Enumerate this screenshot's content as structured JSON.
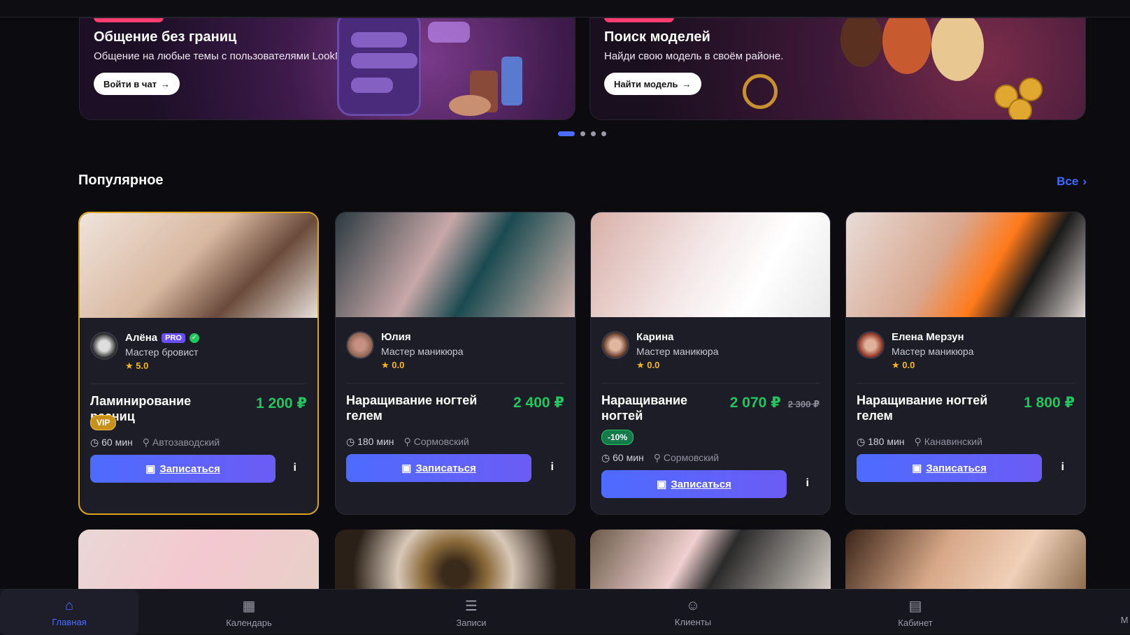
{
  "banners": [
    {
      "title": "Общение без границ",
      "text": "Общение на любые темы с пользователями LookNN",
      "button": "Войти в чат"
    },
    {
      "title": "Поиск моделей",
      "text": "Найди свою модель в своём районе.",
      "button": "Найти модель"
    }
  ],
  "popular": {
    "title": "Популярное",
    "all_label": "Все"
  },
  "cards": [
    {
      "master": "Алёна",
      "pro": "PRO",
      "role": "Мастер бровист",
      "rating": "5.0",
      "service": "Ламинирование ресниц",
      "price": "1 200 ₽",
      "badge": "VIP",
      "duration": "60 мин",
      "district": "Автозаводский",
      "book": "Записаться",
      "info": "i"
    },
    {
      "master": "Юлия",
      "role": "Мастер маникюра",
      "rating": "0.0",
      "service": "Наращивание ногтей гелем",
      "price": "2 400 ₽",
      "duration": "180 мин",
      "district": "Сормовский",
      "book": "Записаться",
      "info": "i"
    },
    {
      "master": "Карина",
      "role": "Мастер маникюра",
      "rating": "0.0",
      "service": "Наращивание ногтей",
      "price": "2 070 ₽",
      "old_price": "2 300 ₽",
      "badge": "-10%",
      "duration": "60 мин",
      "district": "Сормовский",
      "book": "Записаться",
      "info": "i"
    },
    {
      "master": "Елена Мерзун",
      "role": "Мастер маникюра",
      "rating": "0.0",
      "service": "Наращивание ногтей гелем",
      "price": "1 800 ₽",
      "duration": "180 мин",
      "district": "Канавинский",
      "book": "Записаться",
      "info": "i"
    }
  ],
  "nav": [
    {
      "label": "Главная",
      "icon": "home-icon"
    },
    {
      "label": "Календарь",
      "icon": "calendar-icon"
    },
    {
      "label": "Записи",
      "icon": "list-icon"
    },
    {
      "label": "Клиенты",
      "icon": "users-icon"
    },
    {
      "label": "Кабинет",
      "icon": "briefcase-icon"
    }
  ],
  "nav_overflow": "M",
  "colors": {
    "accent": "#4a6cff",
    "price": "#22c55e",
    "vip_border": "#d9a520"
  }
}
